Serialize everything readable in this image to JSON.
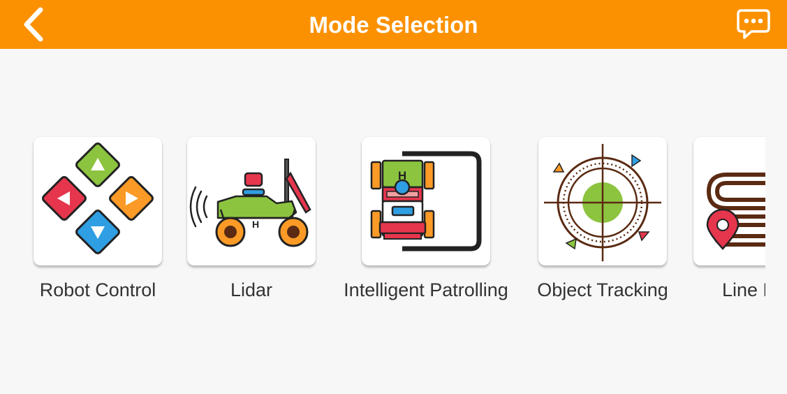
{
  "header": {
    "title": "Mode Selection",
    "back_icon": "chevron-left-icon",
    "chat_icon": "chat-bubble-icon"
  },
  "colors": {
    "header": "#fb9100",
    "background": "#f7f7f7",
    "card": "#ffffff"
  },
  "modes": [
    {
      "label": "Robot Control",
      "icon": "dpad-icon"
    },
    {
      "label": "Lidar",
      "icon": "lidar-robot-icon"
    },
    {
      "label": "Intelligent Patrolling",
      "icon": "patrol-robot-icon"
    },
    {
      "label": "Object Tracking",
      "icon": "crosshair-target-icon"
    },
    {
      "label": "Line Foll",
      "icon": "map-pin-line-icon"
    }
  ]
}
